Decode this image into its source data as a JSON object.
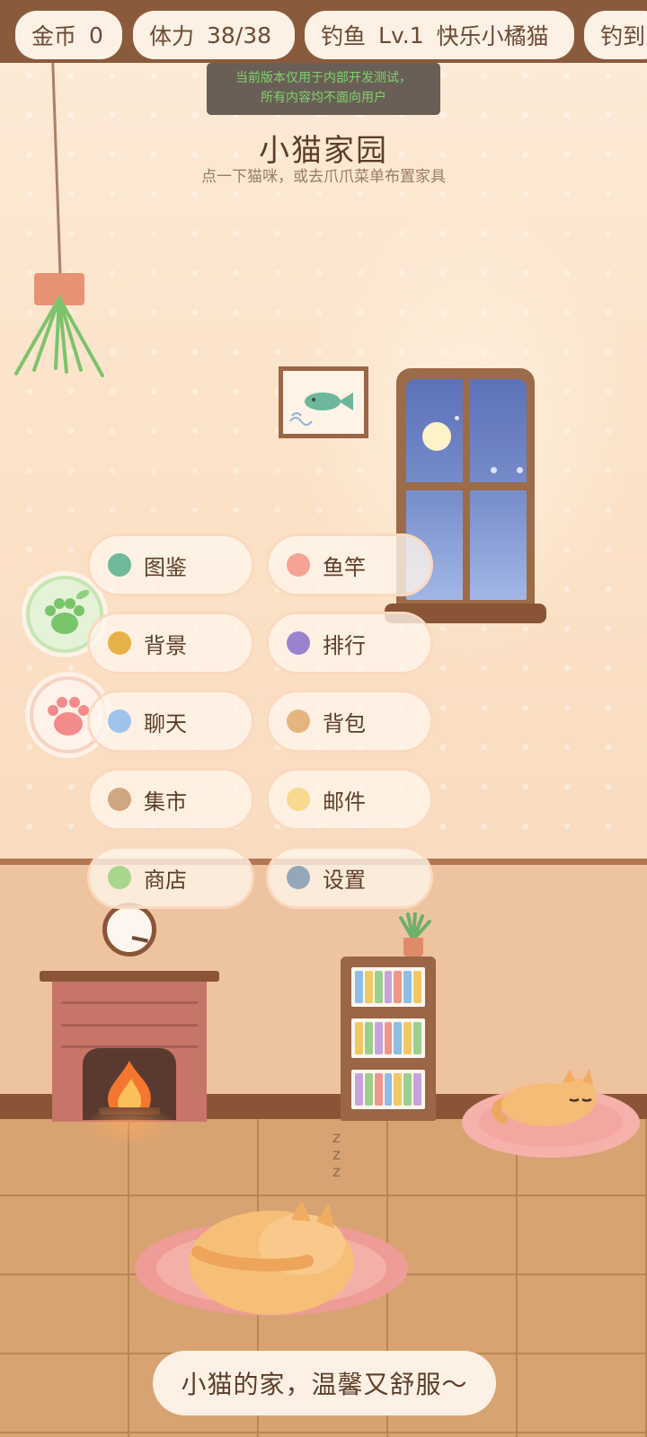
{
  "topbar": {
    "coins_label": "金币",
    "coins_value": "0",
    "stamina_label": "体力",
    "stamina_value": "38/38",
    "fishing_label": "钓鱼",
    "fishing_level": "Lv.1",
    "fishing_title": "快乐小橘猫",
    "catch_label": "钓到"
  },
  "dev_banner": {
    "line1": "当前版本仅用于内部开发测试，",
    "line2": "所有内容均不面向用户"
  },
  "header": {
    "title": "小猫家园",
    "subtitle": "点一下猫咪，或去爪爪菜单布置家具"
  },
  "side_buttons": [
    {
      "name": "green-paw",
      "icon": "green-paw-icon"
    },
    {
      "name": "pink-paw",
      "icon": "pink-paw-icon"
    }
  ],
  "menu": {
    "items": [
      {
        "label": "图鉴",
        "color": "#6fb99a"
      },
      {
        "label": "鱼竿",
        "color": "#f4a395"
      },
      {
        "label": "背景",
        "color": "#e6b146"
      },
      {
        "label": "排行",
        "color": "#9b82cf"
      },
      {
        "label": "聊天",
        "color": "#9fc3ea"
      },
      {
        "label": "背包",
        "color": "#e5b580"
      },
      {
        "label": "集市",
        "color": "#d1a782"
      },
      {
        "label": "邮件",
        "color": "#f9d88f"
      },
      {
        "label": "商店",
        "color": "#a8d68c"
      },
      {
        "label": "设置",
        "color": "#93a7b9"
      }
    ]
  },
  "scene": {
    "zzz": "z z z"
  },
  "caption": "小猫的家，温馨又舒服～"
}
